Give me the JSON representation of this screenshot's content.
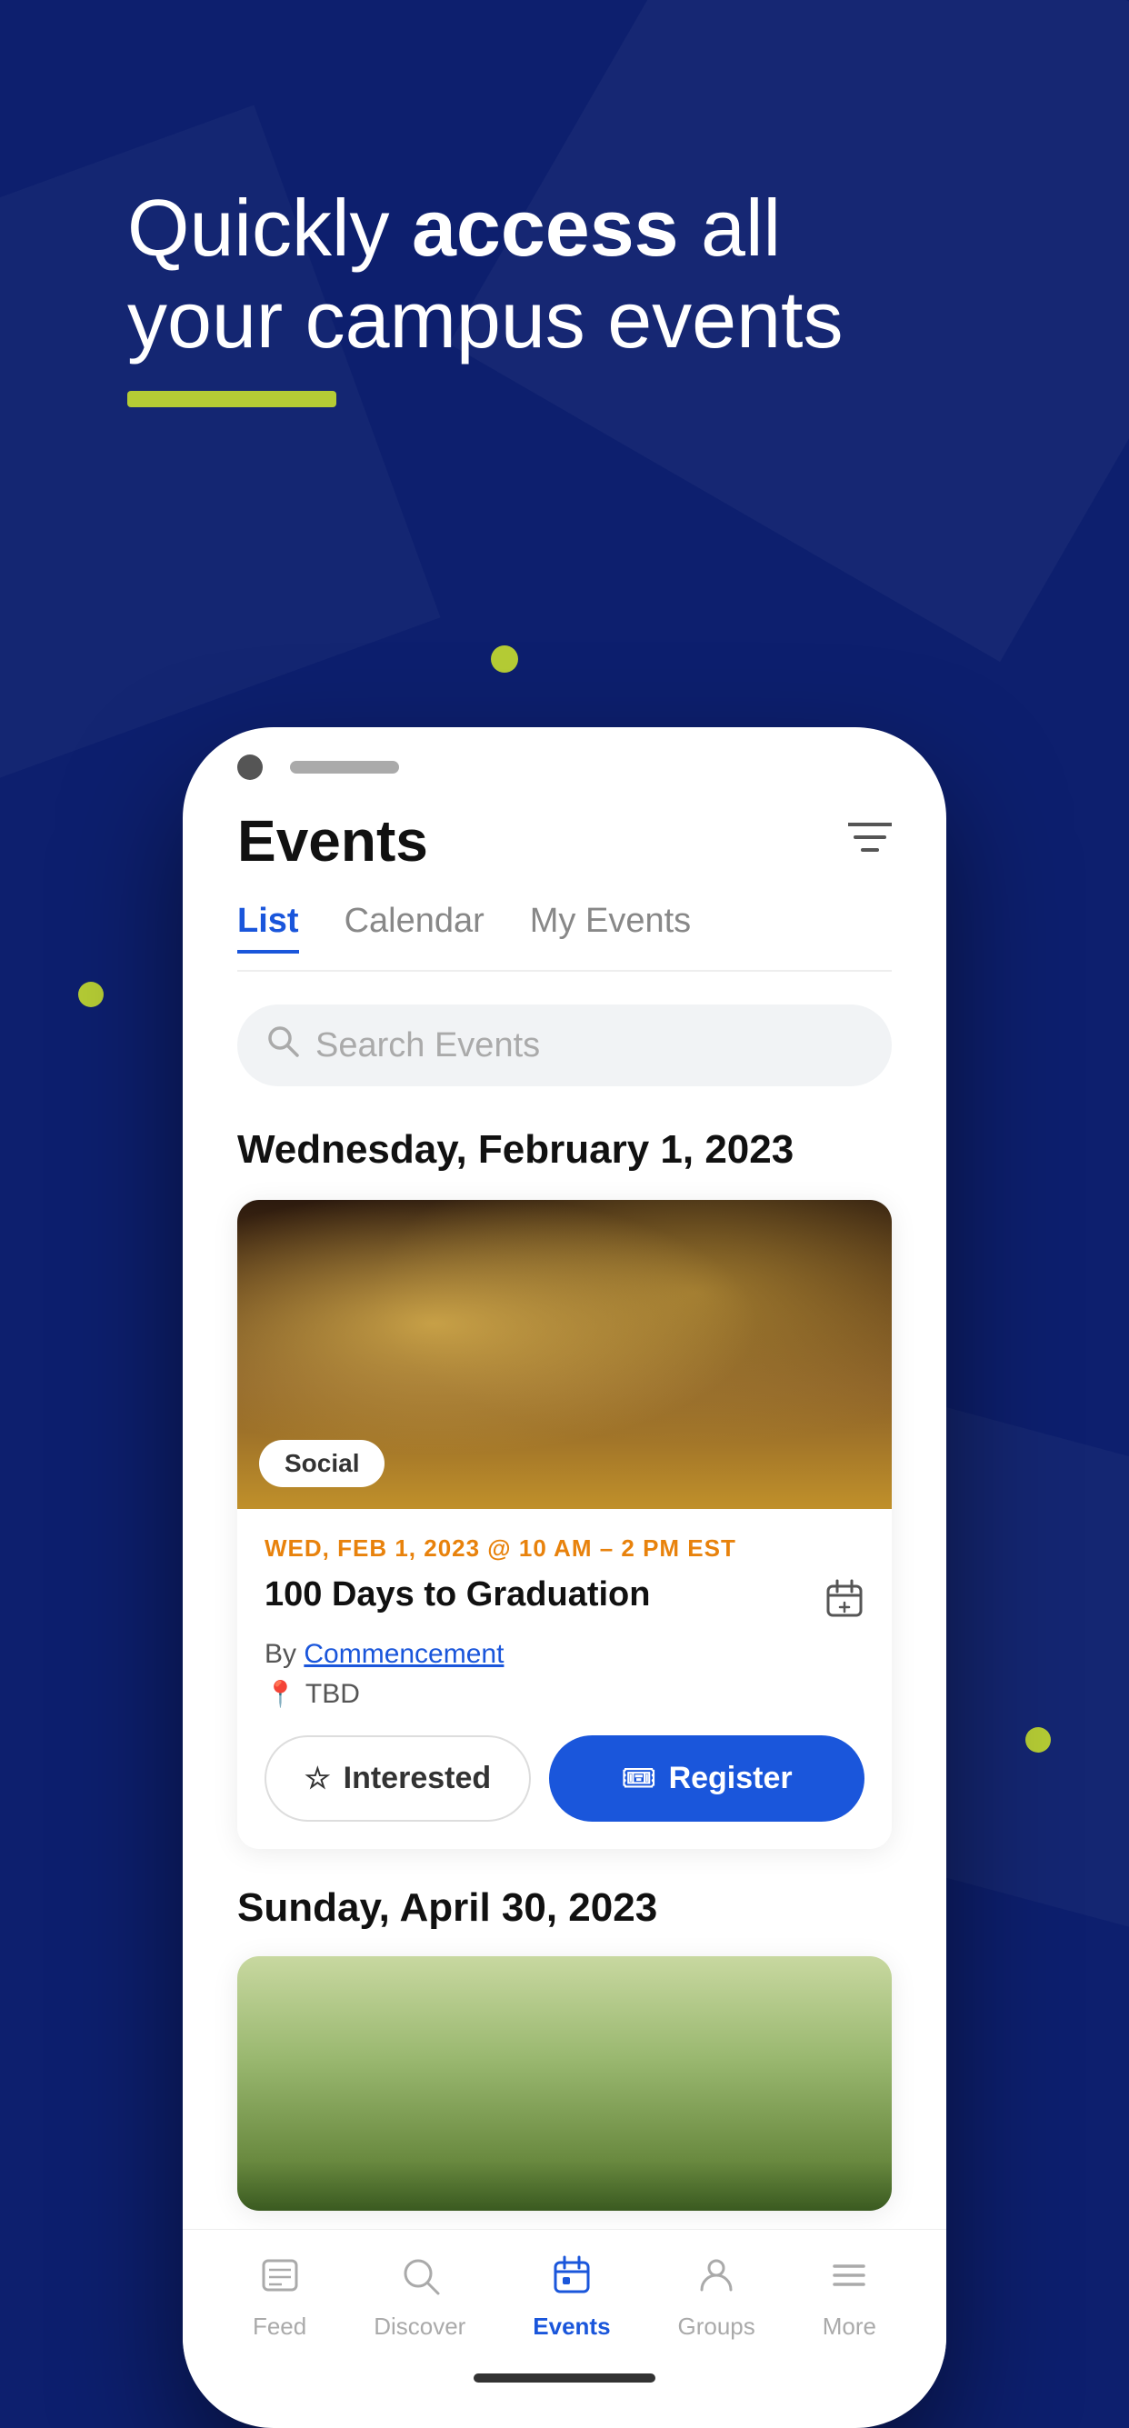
{
  "background": {
    "color": "#0d1f6e"
  },
  "hero": {
    "line1": "Quickly ",
    "line1_bold": "access",
    "line1_end": " all",
    "line2": "your campus events"
  },
  "dots": {
    "center": {
      "color": "#b5cc35"
    },
    "left": {
      "color": "#b5cc35"
    },
    "right": {
      "color": "#b5cc35"
    }
  },
  "app": {
    "title": "Events",
    "filter_label": "filter",
    "tabs": [
      {
        "label": "List",
        "active": true
      },
      {
        "label": "Calendar",
        "active": false
      },
      {
        "label": "My Events",
        "active": false
      }
    ],
    "search": {
      "placeholder": "Search Events"
    },
    "sections": [
      {
        "date": "Wednesday, February 1, 2023",
        "events": [
          {
            "tag": "Social",
            "date_line": "WED, FEB 1, 2023 @ 10 AM – 2 PM EST",
            "title": "100 Days to Graduation",
            "organizer_prefix": "By ",
            "organizer": "Commencement",
            "location": "TBD",
            "btn_interested": "Interested",
            "btn_register": "Register"
          }
        ]
      },
      {
        "date": "Sunday, April 30, 2023",
        "events": []
      }
    ],
    "bottom_nav": [
      {
        "icon": "feed",
        "label": "Feed",
        "active": false
      },
      {
        "icon": "discover",
        "label": "Discover",
        "active": false
      },
      {
        "icon": "events",
        "label": "Events",
        "active": true
      },
      {
        "icon": "groups",
        "label": "Groups",
        "active": false
      },
      {
        "icon": "more",
        "label": "More",
        "active": false
      }
    ]
  }
}
